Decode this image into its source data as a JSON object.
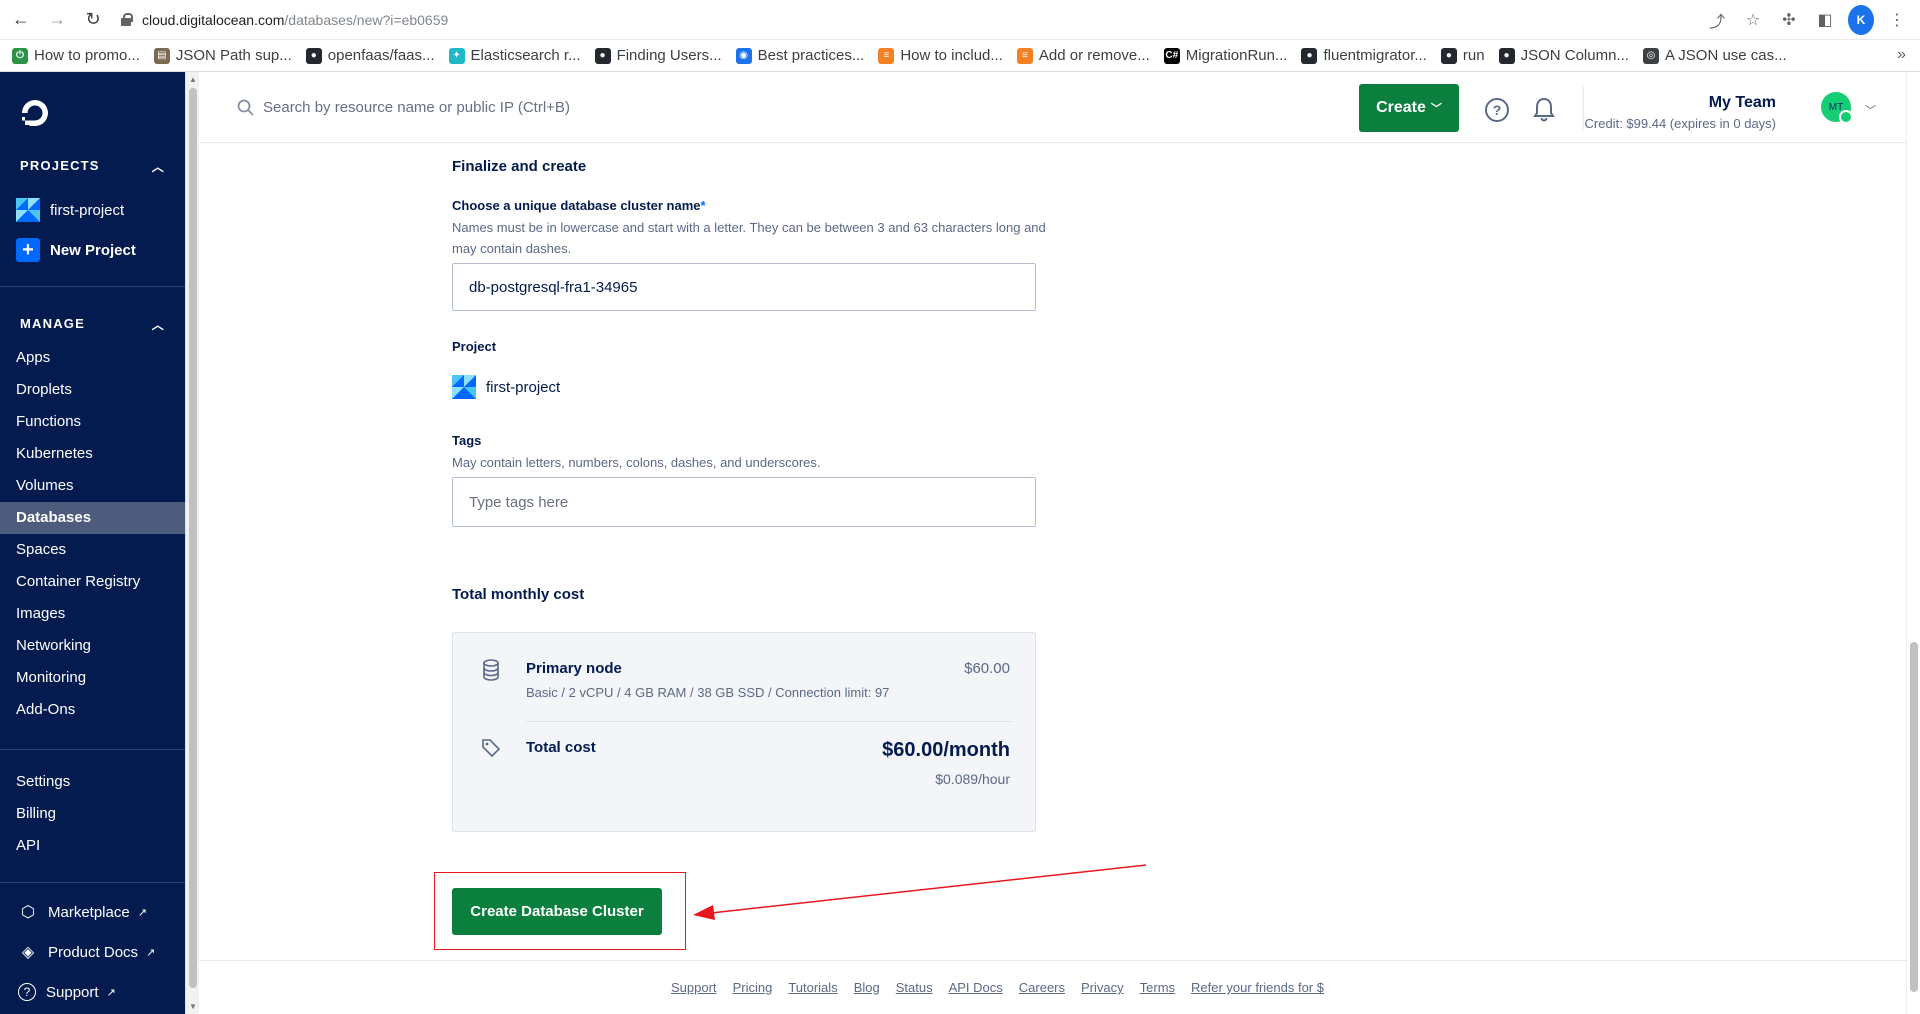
{
  "browser": {
    "url_host": "cloud.digitalocean.com",
    "url_path": "/databases/new?i=eb0659",
    "profile_letter": "K",
    "bookmarks": [
      {
        "label": "How to promo...",
        "color": "#2b9348",
        "glyph": "⏻"
      },
      {
        "label": "JSON Path sup...",
        "color": "#7a6a4f",
        "glyph": "▤"
      },
      {
        "label": "openfaas/faas...",
        "color": "#24292f",
        "glyph": "●"
      },
      {
        "label": "Elasticsearch r...",
        "color": "#1eb8c8",
        "glyph": "✦"
      },
      {
        "label": "Finding Users...",
        "color": "#24292f",
        "glyph": "●"
      },
      {
        "label": "Best practices...",
        "color": "#1a73e8",
        "glyph": "◉"
      },
      {
        "label": "How to includ...",
        "color": "#f48024",
        "glyph": "≡"
      },
      {
        "label": "Add or remove...",
        "color": "#f48024",
        "glyph": "≡"
      },
      {
        "label": "MigrationRun...",
        "color": "#000000",
        "glyph": "C#"
      },
      {
        "label": "fluentmigrator...",
        "color": "#24292f",
        "glyph": "●"
      },
      {
        "label": "run",
        "color": "#24292f",
        "glyph": "●"
      },
      {
        "label": "JSON Column...",
        "color": "#24292f",
        "glyph": "●"
      },
      {
        "label": "A JSON use cas...",
        "color": "#3c4043",
        "glyph": "◎"
      }
    ]
  },
  "sidebar": {
    "projects_heading": "PROJECTS",
    "project_name": "first-project",
    "new_project_label": "New Project",
    "manage_heading": "MANAGE",
    "manage_items": [
      {
        "label": "Apps",
        "active": false
      },
      {
        "label": "Droplets",
        "active": false
      },
      {
        "label": "Functions",
        "active": false
      },
      {
        "label": "Kubernetes",
        "active": false
      },
      {
        "label": "Volumes",
        "active": false
      },
      {
        "label": "Databases",
        "active": true
      },
      {
        "label": "Spaces",
        "active": false
      },
      {
        "label": "Container Registry",
        "active": false
      },
      {
        "label": "Images",
        "active": false
      },
      {
        "label": "Networking",
        "active": false
      },
      {
        "label": "Monitoring",
        "active": false
      },
      {
        "label": "Add-Ons",
        "active": false
      }
    ],
    "account_items": [
      {
        "label": "Settings"
      },
      {
        "label": "Billing"
      },
      {
        "label": "API"
      }
    ],
    "external_links": [
      {
        "label": "Marketplace",
        "icon": "cube-icon"
      },
      {
        "label": "Product Docs",
        "icon": "layers-icon"
      },
      {
        "label": "Support",
        "icon": "question-icon"
      }
    ]
  },
  "header": {
    "search_placeholder": "Search by resource name or public IP (Ctrl+B)",
    "create_label": "Create",
    "team_name": "My Team",
    "credit_text": "Credit: $99.44 (expires in 0 days)",
    "avatar_initials": "MT",
    "accent_color": "#0b7f3e"
  },
  "form": {
    "section_title": "Finalize and create",
    "name_label": "Choose a unique database cluster name",
    "name_required_mark": "*",
    "name_help": "Names must be in lowercase and start with a letter. They can be between 3 and 63 characters long and may contain dashes.",
    "name_value": "db-postgresql-fra1-34965",
    "project_label": "Project",
    "project_value": "first-project",
    "tags_label": "Tags",
    "tags_help": "May contain letters, numbers, colons, dashes, and underscores.",
    "tags_placeholder": "Type tags here",
    "cost_title": "Total monthly cost",
    "primary_node_label": "Primary node",
    "primary_node_spec": "Basic / 2 vCPU / 4 GB RAM / 38 GB SSD / Connection limit: 97",
    "primary_node_price": "$60.00",
    "total_cost_label": "Total cost",
    "total_month": "$60.00/month",
    "total_hour": "$0.089/hour",
    "submit_label": "Create Database Cluster"
  },
  "footer": {
    "links": [
      "Support",
      "Pricing",
      "Tutorials",
      "Blog",
      "Status",
      "API Docs",
      "Careers",
      "Privacy",
      "Terms",
      "Refer your friends for $"
    ]
  }
}
